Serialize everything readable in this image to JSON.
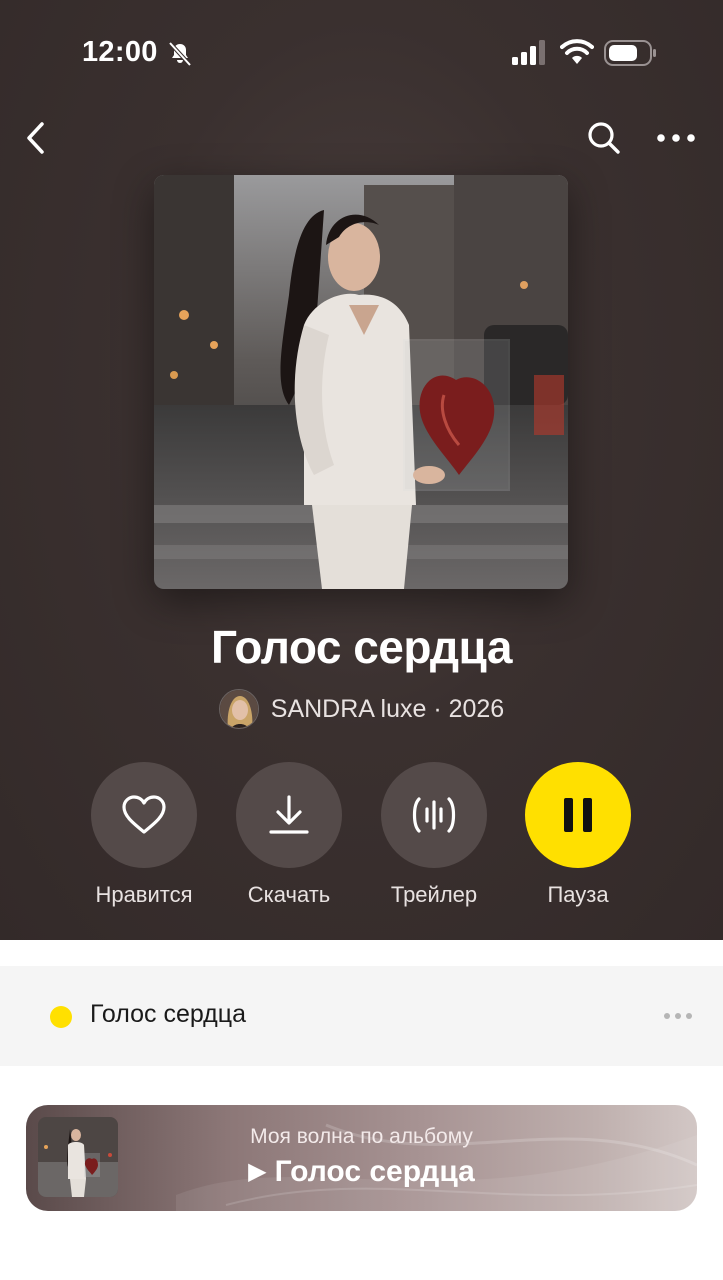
{
  "status_bar": {
    "time": "12:00"
  },
  "album": {
    "title": "Голос сердца",
    "artist_line": "SANDRA luxe · 2026"
  },
  "actions": [
    {
      "label": "Нравится",
      "icon": "heart-icon"
    },
    {
      "label": "Скачать",
      "icon": "download-icon"
    },
    {
      "label": "Трейлер",
      "icon": "trailer-wave-icon"
    },
    {
      "label": "Пауза",
      "icon": "pause-icon"
    }
  ],
  "track": {
    "title": "Голос сердца"
  },
  "wave": {
    "subtitle": "Моя волна по альбому",
    "title": "Голос сердца"
  },
  "colors": {
    "accent": "#ffe000",
    "header_bg": "#3a302f",
    "action_bg": "#544a49"
  }
}
